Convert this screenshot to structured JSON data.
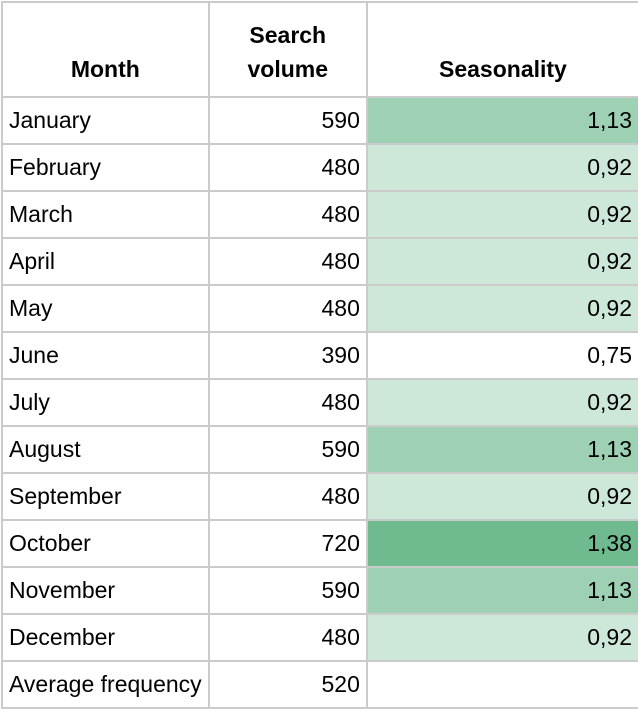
{
  "headers": {
    "month": "Month",
    "search_volume_line1": "Search",
    "search_volume_line2": "volume",
    "seasonality": "Seasonality"
  },
  "colors": {
    "high": "#6fbb8f",
    "medium": "#9ed0b4",
    "low": "#cde8d9",
    "none": "#ffffff",
    "grid": "#cbcbcb"
  },
  "rows": [
    {
      "month": "January",
      "volume": "590",
      "seasonality": "1,13",
      "level": "medium"
    },
    {
      "month": "February",
      "volume": "480",
      "seasonality": "0,92",
      "level": "low"
    },
    {
      "month": "March",
      "volume": "480",
      "seasonality": "0,92",
      "level": "low"
    },
    {
      "month": "April",
      "volume": "480",
      "seasonality": "0,92",
      "level": "low"
    },
    {
      "month": "May",
      "volume": "480",
      "seasonality": "0,92",
      "level": "low"
    },
    {
      "month": "June",
      "volume": "390",
      "seasonality": "0,75",
      "level": "none"
    },
    {
      "month": "July",
      "volume": "480",
      "seasonality": "0,92",
      "level": "low"
    },
    {
      "month": "August",
      "volume": "590",
      "seasonality": "1,13",
      "level": "medium"
    },
    {
      "month": "September",
      "volume": "480",
      "seasonality": "0,92",
      "level": "low"
    },
    {
      "month": "October",
      "volume": "720",
      "seasonality": "1,38",
      "level": "high"
    },
    {
      "month": "November",
      "volume": "590",
      "seasonality": "1,13",
      "level": "medium"
    },
    {
      "month": "December",
      "volume": "480",
      "seasonality": "0,92",
      "level": "low"
    }
  ],
  "footer": {
    "label": "Average frequency",
    "volume": "520",
    "seasonality": ""
  }
}
